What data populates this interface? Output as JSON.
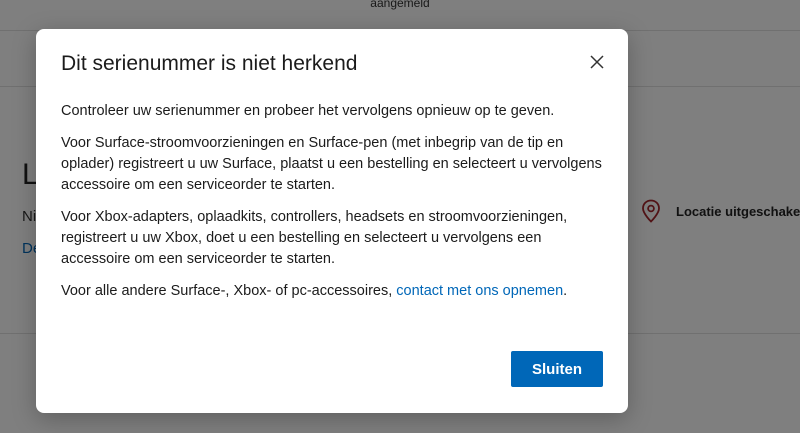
{
  "background": {
    "topbar_text": "aangemeld",
    "heading": "L",
    "subtext": "Ni",
    "link": "De",
    "location": {
      "icon": "location-pin-icon",
      "label": "Locatie uitgeschakeld"
    }
  },
  "dialog": {
    "title": "Dit serienummer is niet herkend",
    "close_icon": "close-icon",
    "paragraphs": [
      "Controleer uw serienummer en probeer het vervolgens opnieuw op te geven.",
      "Voor Surface-stroomvoorzieningen en Surface-pen (met inbegrip van de tip en oplader) registreert u uw Surface, plaatst u een bestelling en selecteert u vervolgens accessoire om een serviceorder te starten.",
      "Voor Xbox-adapters, oplaadkits, controllers, headsets en stroomvoorzieningen, registreert u uw Xbox, doet u een bestelling en selecteert u vervolgens een accessoire om een serviceorder te starten."
    ],
    "last_paragraph": {
      "text": "Voor alle andere Surface-, Xbox- of pc-accessoires, ",
      "link": "contact met ons opnemen",
      "suffix": "."
    },
    "close_button": "Sluiten"
  },
  "colors": {
    "accent": "#0067b8",
    "location_icon": "#a4262c"
  }
}
